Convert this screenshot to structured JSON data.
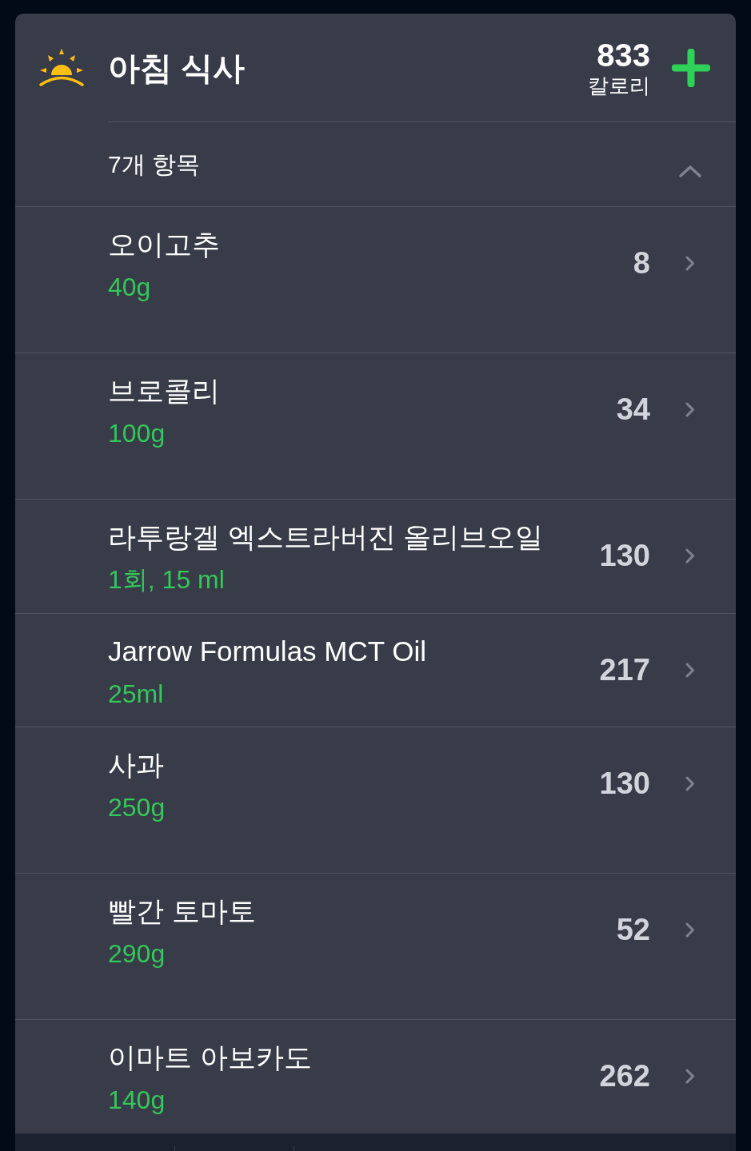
{
  "meal": {
    "title": "아침 식사",
    "calories": "833",
    "calories_unit": "칼로리"
  },
  "summary": {
    "label": "7개 항목",
    "expanded": true
  },
  "items": [
    {
      "name": "오이고추",
      "amount": "40g",
      "calories": "8"
    },
    {
      "name": "브로콜리",
      "amount": "100g",
      "calories": "34"
    },
    {
      "name": "라투랑겔 엑스트라버진 올리브오일",
      "amount": "1회, 15 ml",
      "calories": "130"
    },
    {
      "name": "Jarrow Formulas MCT Oil",
      "amount": "25ml",
      "calories": "217"
    },
    {
      "name": "사과",
      "amount": "250g",
      "calories": "130"
    },
    {
      "name": "빨간 토마토",
      "amount": "290g",
      "calories": "52"
    },
    {
      "name": "이마트 아보카도",
      "amount": "140g",
      "calories": "262"
    }
  ]
}
